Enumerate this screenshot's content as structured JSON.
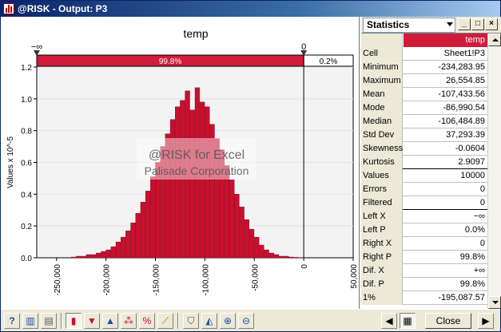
{
  "window": {
    "title": "@RISK - Output: P3"
  },
  "chart_data": {
    "type": "bar",
    "title": "temp",
    "ylabel": "Values x 10^-5",
    "xlabel": "",
    "xlim": [
      -270000,
      50000
    ],
    "ylim": [
      0,
      1.2
    ],
    "yticks": [
      "0.0",
      "0.2",
      "0.4",
      "0.6",
      "0.8",
      "1.0",
      "1.2"
    ],
    "yticks_values": [
      0,
      0.2,
      0.4,
      0.6,
      0.8,
      1.0,
      1.2
    ],
    "xticks": [
      "-250,000",
      "-200,000",
      "-150,000",
      "-100,000",
      "-50,000",
      "0",
      "50,000"
    ],
    "xticks_values": [
      -250000,
      -200000,
      -150000,
      -100000,
      -50000,
      0,
      50000
    ],
    "bin_width": 5000,
    "bins_start": -235000,
    "values": [
      0.005,
      0.01,
      0.01,
      0.02,
      0.02,
      0.03,
      0.04,
      0.05,
      0.07,
      0.1,
      0.13,
      0.17,
      0.22,
      0.28,
      0.35,
      0.42,
      0.51,
      0.6,
      0.7,
      0.78,
      0.87,
      0.95,
      0.99,
      1.05,
      0.93,
      1.07,
      0.98,
      0.95,
      0.84,
      0.75,
      0.68,
      0.58,
      0.49,
      0.4,
      0.32,
      0.24,
      0.18,
      0.13,
      0.08,
      0.05,
      0.03,
      0.02,
      0.01,
      0.01,
      0.005,
      0.003,
      0.002
    ],
    "marker_left": "−∞",
    "marker_right": "0",
    "marker_right_value": 0,
    "left_pct_label": "99.8%",
    "right_pct_label": "0.2%",
    "watermark_line1": "@RISK for Excel",
    "watermark_line2": "Palisade Corporation",
    "colors": {
      "bar": "#c8102e",
      "band": "#d01c3a",
      "plot_bg": "#f3f3f3"
    }
  },
  "stats": {
    "dropdown": "Statistics",
    "header_value": "temp",
    "rows": [
      {
        "label": "Cell",
        "value": "Sheet1!P3"
      },
      {
        "label": "Minimum",
        "value": "-234,283.95"
      },
      {
        "label": "Maximum",
        "value": "26,554.85"
      },
      {
        "label": "Mean",
        "value": "-107,433.56"
      },
      {
        "label": "Mode",
        "value": "-86,990.54"
      },
      {
        "label": "Median",
        "value": "-106,484.89"
      },
      {
        "label": "Std Dev",
        "value": "37,293.39"
      },
      {
        "label": "Skewness",
        "value": "-0.0604"
      },
      {
        "label": "Kurtosis",
        "value": "2.9097"
      },
      {
        "label": "Values",
        "value": "10000"
      },
      {
        "label": "Errors",
        "value": "0"
      },
      {
        "label": "Filtered",
        "value": "0"
      },
      {
        "label": "Left X",
        "value": "−∞"
      },
      {
        "label": "Left P",
        "value": "0.0%"
      },
      {
        "label": "Right X",
        "value": "0"
      },
      {
        "label": "Right P",
        "value": "99.8%"
      },
      {
        "label": "Dif. X",
        "value": "+∞"
      },
      {
        "label": "Dif. P",
        "value": "99.8%"
      },
      {
        "label": "1%",
        "value": "-195,087.57"
      }
    ],
    "separators_after": [
      8,
      11
    ]
  },
  "toolbar": {
    "close_label": "Close"
  }
}
